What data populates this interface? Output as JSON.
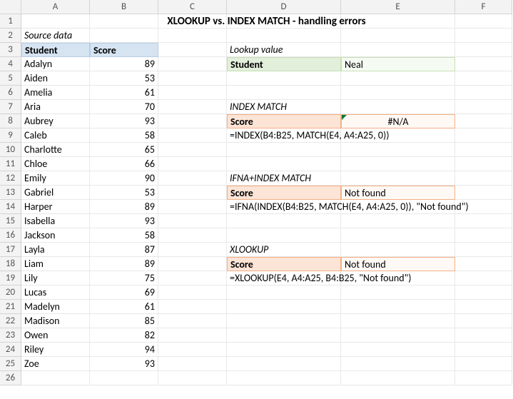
{
  "columns": [
    "A",
    "B",
    "C",
    "D",
    "E",
    "F"
  ],
  "title": "XLOOKUP vs. INDEX MATCH - handling errors",
  "source_label": "Source data",
  "headers": {
    "student": "Student",
    "score": "Score"
  },
  "students": [
    {
      "name": "Adalyn",
      "score": 89
    },
    {
      "name": "Aiden",
      "score": 53
    },
    {
      "name": "Amelia",
      "score": 61
    },
    {
      "name": "Aria",
      "score": 70
    },
    {
      "name": "Aubrey",
      "score": 93
    },
    {
      "name": "Caleb",
      "score": 58
    },
    {
      "name": "Charlotte",
      "score": 65
    },
    {
      "name": "Chloe",
      "score": 66
    },
    {
      "name": "Emily",
      "score": 90
    },
    {
      "name": "Gabriel",
      "score": 53
    },
    {
      "name": "Harper",
      "score": 89
    },
    {
      "name": "Isabella",
      "score": 93
    },
    {
      "name": "Jackson",
      "score": 58
    },
    {
      "name": "Layla",
      "score": 87
    },
    {
      "name": "Liam",
      "score": 89
    },
    {
      "name": "Lily",
      "score": 75
    },
    {
      "name": "Lucas",
      "score": 69
    },
    {
      "name": "Madelyn",
      "score": 61
    },
    {
      "name": "Madison",
      "score": 85
    },
    {
      "name": "Owen",
      "score": 82
    },
    {
      "name": "Riley",
      "score": 94
    },
    {
      "name": "Zoe",
      "score": 93
    }
  ],
  "lookup": {
    "label": "Lookup value",
    "field": "Student",
    "value": "Neal"
  },
  "sections": {
    "index_match": {
      "title": "INDEX MATCH",
      "field": "Score",
      "result": "#N/A",
      "formula": "=INDEX(B4:B25, MATCH(E4, A4:A25, 0))"
    },
    "ifna_index_match": {
      "title": "IFNA+INDEX MATCH",
      "field": "Score",
      "result": "Not found",
      "formula": "=IFNA(INDEX(B4:B25, MATCH(E4, A4:A25, 0)), \"Not found\")"
    },
    "xlookup": {
      "title": "XLOOKUP",
      "field": "Score",
      "result": "Not found",
      "formula": "=XLOOKUP(E4, A4:A25, B4:B25, \"Not found\")"
    }
  },
  "chart_data": {
    "type": "table",
    "title": "XLOOKUP vs. INDEX MATCH - handling errors",
    "columns": [
      "Student",
      "Score"
    ],
    "rows": [
      [
        "Adalyn",
        89
      ],
      [
        "Aiden",
        53
      ],
      [
        "Amelia",
        61
      ],
      [
        "Aria",
        70
      ],
      [
        "Aubrey",
        93
      ],
      [
        "Caleb",
        58
      ],
      [
        "Charlotte",
        65
      ],
      [
        "Chloe",
        66
      ],
      [
        "Emily",
        90
      ],
      [
        "Gabriel",
        53
      ],
      [
        "Harper",
        89
      ],
      [
        "Isabella",
        93
      ],
      [
        "Jackson",
        58
      ],
      [
        "Layla",
        87
      ],
      [
        "Liam",
        89
      ],
      [
        "Lily",
        75
      ],
      [
        "Lucas",
        69
      ],
      [
        "Madelyn",
        61
      ],
      [
        "Madison",
        85
      ],
      [
        "Owen",
        82
      ],
      [
        "Riley",
        94
      ],
      [
        "Zoe",
        93
      ]
    ],
    "lookup_value": "Neal",
    "results": {
      "INDEX MATCH": "#N/A",
      "IFNA+INDEX MATCH": "Not found",
      "XLOOKUP": "Not found"
    }
  }
}
